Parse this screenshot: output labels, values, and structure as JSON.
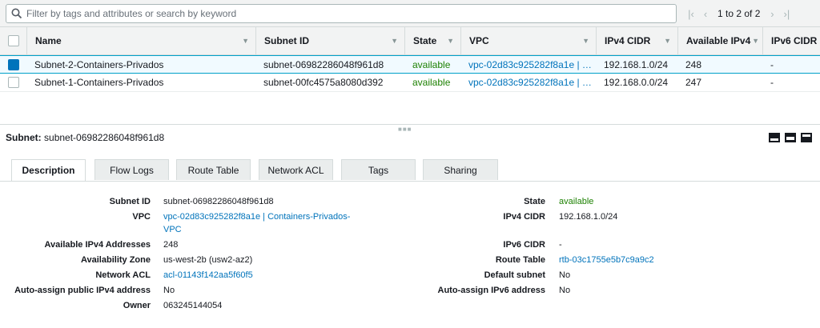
{
  "filter": {
    "placeholder": "Filter by tags and attributes or search by keyword",
    "pagination": "1 to 2 of 2"
  },
  "table": {
    "columns": [
      "Name",
      "Subnet ID",
      "State",
      "VPC",
      "IPv4 CIDR",
      "Available IPv4",
      "IPv6 CIDR"
    ],
    "rows": [
      {
        "selected": true,
        "name": "Subnet-2-Containers-Privados",
        "subnet_id": "subnet-06982286048f961d8",
        "state": "available",
        "vpc": "vpc-02d83c925282f8a1e | Containers-Privados-VPC",
        "ipv4_cidr": "192.168.1.0/24",
        "available_ipv4": "248",
        "ipv6_cidr": "-"
      },
      {
        "selected": false,
        "name": "Subnet-1-Containers-Privados",
        "subnet_id": "subnet-00fc4575a8080d392",
        "state": "available",
        "vpc": "vpc-02d83c925282f8a1e | Containers-Privados-VPC",
        "ipv4_cidr": "192.168.0.0/24",
        "available_ipv4": "247",
        "ipv6_cidr": "-"
      }
    ]
  },
  "detail": {
    "title_label": "Subnet:",
    "title_value": "subnet-06982286048f961d8",
    "tabs": [
      "Description",
      "Flow Logs",
      "Route Table",
      "Network ACL",
      "Tags",
      "Sharing"
    ],
    "active_tab": "Description",
    "left": {
      "subnet_id": {
        "label": "Subnet ID",
        "value": "subnet-06982286048f961d8"
      },
      "vpc": {
        "label": "VPC",
        "value_line1": "vpc-02d83c925282f8a1e | Containers-Privados-",
        "value_line2": "VPC"
      },
      "available_ipv4": {
        "label": "Available IPv4 Addresses",
        "value": "248"
      },
      "az": {
        "label": "Availability Zone",
        "value": "us-west-2b (usw2-az2)"
      },
      "nacl": {
        "label": "Network ACL",
        "value": "acl-01143f142aa5f60f5"
      },
      "auto_ipv4": {
        "label": "Auto-assign public IPv4 address",
        "value": "No"
      },
      "owner": {
        "label": "Owner",
        "value": "063245144054"
      }
    },
    "right": {
      "state": {
        "label": "State",
        "value": "available"
      },
      "ipv4_cidr": {
        "label": "IPv4 CIDR",
        "value": "192.168.1.0/24"
      },
      "ipv6_cidr": {
        "label": "IPv6 CIDR",
        "value": "-"
      },
      "route_table": {
        "label": "Route Table",
        "value": "rtb-03c1755e5b7c9a9c2"
      },
      "default_subnet": {
        "label": "Default subnet",
        "value": "No"
      },
      "auto_ipv6": {
        "label": "Auto-assign IPv6 address",
        "value": "No"
      }
    }
  },
  "colors": {
    "link": "#0073bb",
    "available": "#1d8102",
    "selected_row": "#f1faff",
    "checkbox_checked": "#0073bb"
  }
}
